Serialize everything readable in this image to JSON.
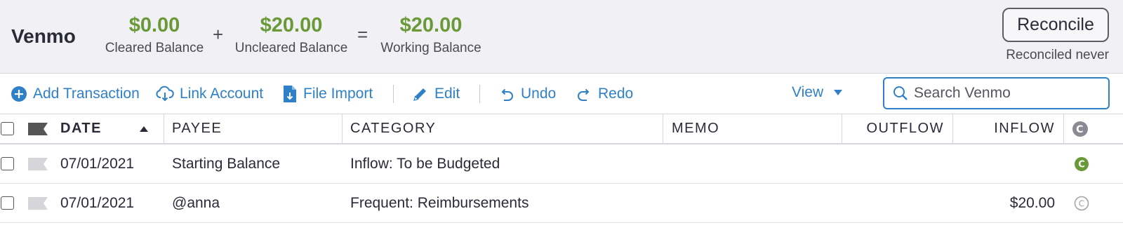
{
  "account": {
    "name": "Venmo",
    "cleared": {
      "amount": "$0.00",
      "label": "Cleared Balance"
    },
    "plus": "+",
    "uncleared": {
      "amount": "$20.00",
      "label": "Uncleared Balance"
    },
    "equals": "=",
    "working": {
      "amount": "$20.00",
      "label": "Working Balance"
    },
    "reconcile_label": "Reconcile",
    "reconciled_note": "Reconciled never"
  },
  "toolbar": {
    "add_transaction": "Add Transaction",
    "link_account": "Link Account",
    "file_import": "File Import",
    "edit": "Edit",
    "undo": "Undo",
    "redo": "Redo",
    "view": "View",
    "search_placeholder": "Search Venmo"
  },
  "table": {
    "headers": {
      "date": "DATE",
      "payee": "PAYEE",
      "category": "CATEGORY",
      "memo": "MEMO",
      "outflow": "OUTFLOW",
      "inflow": "INFLOW"
    },
    "rows": [
      {
        "date": "07/01/2021",
        "payee": "Starting Balance",
        "category": "Inflow: To be Budgeted",
        "memo": "",
        "outflow": "",
        "inflow": "",
        "cleared": true
      },
      {
        "date": "07/01/2021",
        "payee": "@anna",
        "category": "Frequent: Reimbursements",
        "memo": "",
        "outflow": "",
        "inflow": "$20.00",
        "cleared": false
      }
    ]
  },
  "colors": {
    "accent": "#2f80c7",
    "balance_green": "#6a9a37",
    "header_bg": "#f0f0f5"
  },
  "icons": [
    "plus-circle-icon",
    "cloud-download-icon",
    "file-import-icon",
    "pencil-icon",
    "undo-icon",
    "redo-icon",
    "chevron-down-icon",
    "search-icon",
    "flag-icon",
    "sort-up-icon",
    "cleared-icon"
  ]
}
